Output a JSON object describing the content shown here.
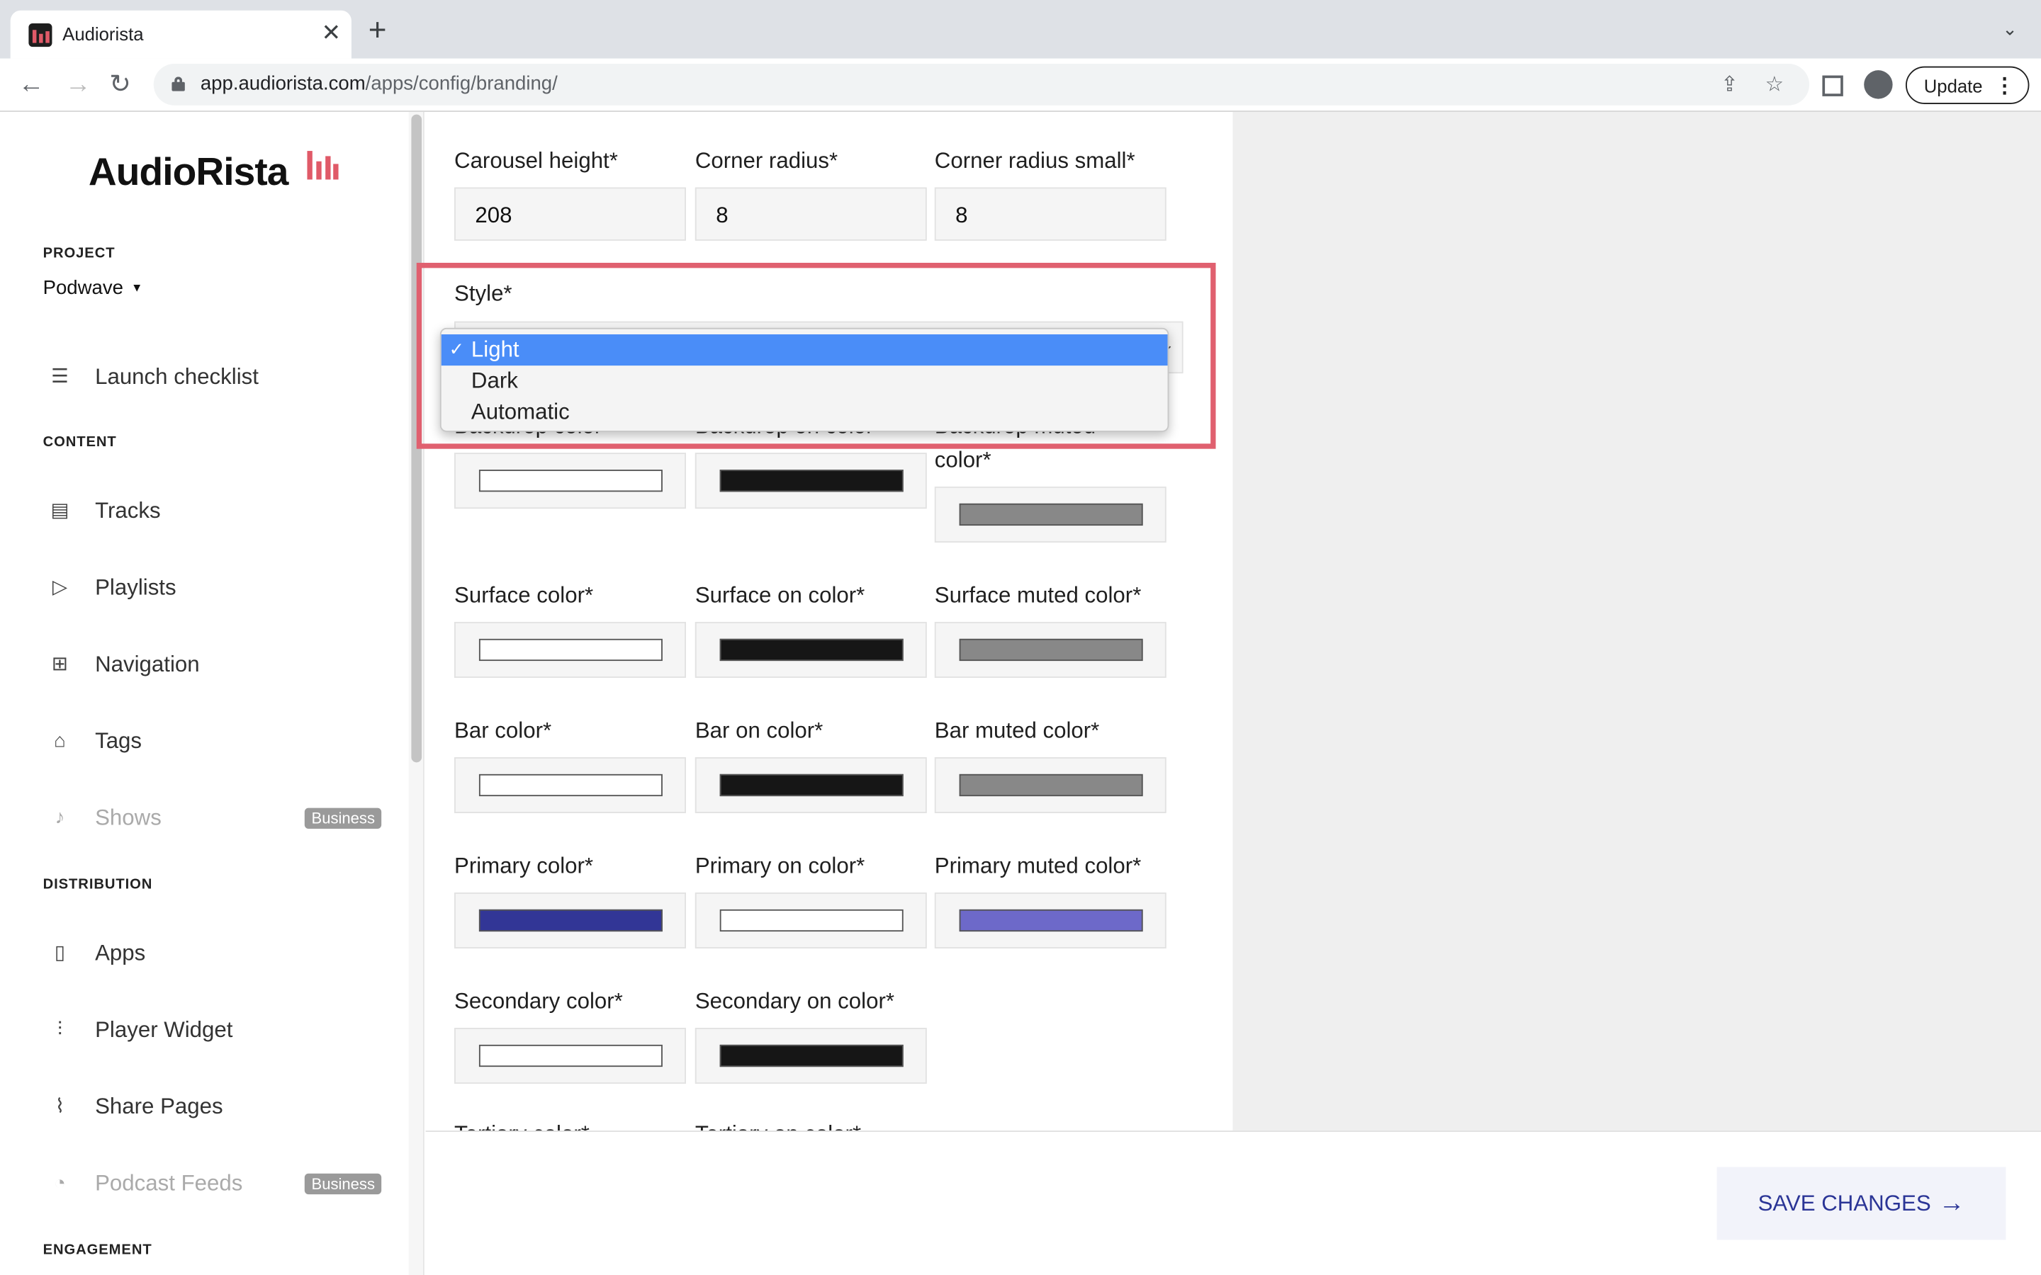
{
  "browser": {
    "tab_title": "Audiorista",
    "tab_close": "✕",
    "new_tab": "+",
    "tab_menu": "⌄",
    "url_host": "app.audiorista.com",
    "url_path": "/apps/config/branding/",
    "update_label": "Update",
    "menu_dots": "⋮"
  },
  "sidebar": {
    "logo_text": "AudioRista",
    "project_label": "PROJECT",
    "project_name": "Podwave",
    "items": [
      {
        "label": "Launch checklist",
        "icon": "list-icon",
        "glyph": "☰"
      },
      {
        "label": "Tracks",
        "icon": "document-icon",
        "glyph": "▤"
      },
      {
        "label": "Playlists",
        "icon": "play-icon",
        "glyph": "▷"
      },
      {
        "label": "Navigation",
        "icon": "grid-icon",
        "glyph": "⊞"
      },
      {
        "label": "Tags",
        "icon": "tag-icon",
        "glyph": "⌂"
      },
      {
        "label": "Shows",
        "icon": "microphone-icon",
        "glyph": "♪",
        "badge": "Business",
        "disabled": true
      },
      {
        "label": "Apps",
        "icon": "tablet-icon",
        "glyph": "▯"
      },
      {
        "label": "Player Widget",
        "icon": "sliders-icon",
        "glyph": "⫶"
      },
      {
        "label": "Share Pages",
        "icon": "paperclip-icon",
        "glyph": "⌇"
      },
      {
        "label": "Podcast Feeds",
        "icon": "rss-icon",
        "glyph": "◔",
        "badge": "Business",
        "disabled": true
      }
    ],
    "sections": {
      "content": "CONTENT",
      "distribution": "DISTRIBUTION",
      "engagement": "ENGAGEMENT"
    }
  },
  "form": {
    "carousel_height": {
      "label": "Carousel height*",
      "value": "208"
    },
    "corner_radius": {
      "label": "Corner radius*",
      "value": "8"
    },
    "corner_radius_small": {
      "label": "Corner radius small*",
      "value": "8"
    },
    "style": {
      "label": "Style*",
      "options": [
        "Light",
        "Dark",
        "Automatic"
      ],
      "selected": "Light",
      "check": "✓"
    },
    "backdrop": {
      "color_label": "Backdrop color*",
      "on_color_label": "Backdrop on color*",
      "muted_label_line1": "Backdrop muted",
      "muted_label_line2": "color*",
      "colors": [
        "#ffffff",
        "#161616",
        "#888888"
      ]
    },
    "surface": {
      "color_label": "Surface color*",
      "on_color_label": "Surface on color*",
      "muted_label": "Surface muted color*",
      "colors": [
        "#ffffff",
        "#161616",
        "#888888"
      ]
    },
    "bar": {
      "color_label": "Bar color*",
      "on_color_label": "Bar on color*",
      "muted_label": "Bar muted color*",
      "colors": [
        "#ffffff",
        "#161616",
        "#888888"
      ]
    },
    "primary": {
      "color_label": "Primary color*",
      "on_color_label": "Primary on color*",
      "muted_label": "Primary muted color*",
      "colors": [
        "#323696",
        "#ffffff",
        "#6d69c9"
      ]
    },
    "secondary": {
      "color_label": "Secondary color*",
      "on_color_label": "Secondary on color*",
      "colors": [
        "#ffffff",
        "#161616"
      ]
    },
    "tertiary": {
      "color_label": "Tertiary color*",
      "on_color_label": "Tertiary on color*"
    }
  },
  "save_button": {
    "label": "SAVE CHANGES",
    "arrow": "→"
  }
}
